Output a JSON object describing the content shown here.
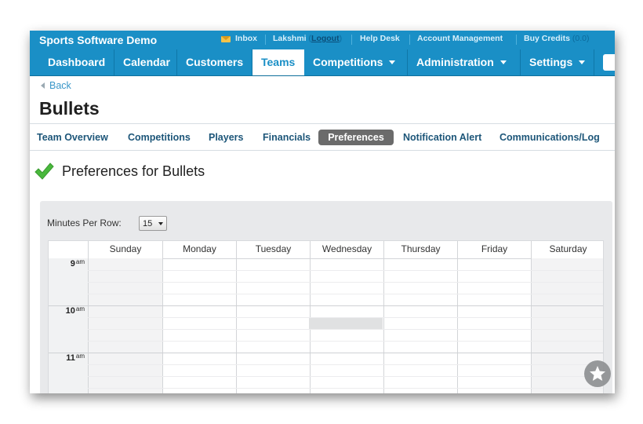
{
  "app": {
    "title": "Sports Software Demo"
  },
  "topbar": {
    "inbox_label": "Inbox",
    "user_name": "Lakshmi",
    "logout_label": "Logout",
    "help_desk_label": "Help Desk",
    "account_management_label": "Account Management",
    "buy_credits_label": "Buy Credits",
    "credits_value": "(0.0)"
  },
  "nav": {
    "items": [
      {
        "label": "Dashboard"
      },
      {
        "label": "Calendar"
      },
      {
        "label": "Customers"
      },
      {
        "label": "Teams"
      },
      {
        "label": "Competitions"
      },
      {
        "label": "Administration"
      },
      {
        "label": "Settings"
      }
    ],
    "active": "Teams"
  },
  "back_label": "Back",
  "page_title": "Bullets",
  "subtabs": {
    "items": [
      {
        "label": "Team Overview"
      },
      {
        "label": "Competitions"
      },
      {
        "label": "Players"
      },
      {
        "label": "Financials"
      },
      {
        "label": "Preferences"
      },
      {
        "label": "Notification Alert"
      },
      {
        "label": "Communications/Log"
      }
    ],
    "active": "Preferences"
  },
  "preferences": {
    "heading": "Preferences for Bullets",
    "minutes_per_row_label": "Minutes Per Row:",
    "minutes_per_row_value": "15"
  },
  "calendar": {
    "days": [
      "Sunday",
      "Monday",
      "Tuesday",
      "Wednesday",
      "Thursday",
      "Friday",
      "Saturday"
    ],
    "hours": [
      {
        "hour": "9",
        "suffix": "am"
      },
      {
        "hour": "10",
        "suffix": "am"
      },
      {
        "hour": "11",
        "suffix": "am"
      }
    ]
  },
  "colors": {
    "brand_blue": "#1a8fc6",
    "active_tab_gray": "#6b6b6b",
    "check_green": "#49b83c",
    "panel_gray": "#e8e9eb"
  },
  "icons": [
    "mail-icon",
    "back-arrow-icon",
    "check-icon",
    "dropdown-caret-icon",
    "feedback-star-icon"
  ]
}
